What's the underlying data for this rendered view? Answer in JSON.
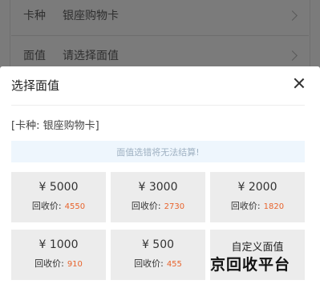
{
  "background_form": {
    "card_type_label": "卡种",
    "card_type_value": "银座购物卡",
    "denomination_label": "面值",
    "denomination_placeholder": "请选择面值"
  },
  "modal": {
    "title": "选择面值",
    "card_type_line": "[卡种: 银座购物卡]",
    "notice": "面值选错将无法结算!",
    "recycle_label": "回收价:",
    "options": [
      {
        "amount": "¥ 5000",
        "price": "4550"
      },
      {
        "amount": "¥ 3000",
        "price": "2730"
      },
      {
        "amount": "¥ 2000",
        "price": "1820"
      },
      {
        "amount": "¥ 1000",
        "price": "910"
      },
      {
        "amount": "¥ 500",
        "price": "455"
      }
    ],
    "custom_option": "自定义面值"
  },
  "watermark": "京回收平台",
  "colors": {
    "overlay": "#7b7b7b",
    "notice_bg": "#eef6fd",
    "tile_bg": "#ececec",
    "price_accent": "#e8632c"
  }
}
